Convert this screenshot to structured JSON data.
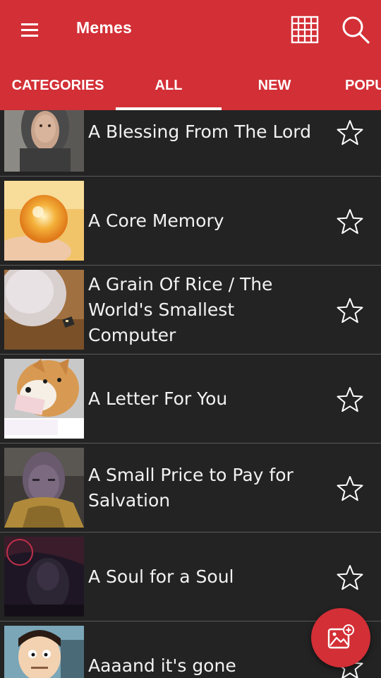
{
  "app": {
    "title": "Memes"
  },
  "tabs": [
    {
      "label": "CATEGORIES",
      "active": false
    },
    {
      "label": "ALL",
      "active": true
    },
    {
      "label": "NEW",
      "active": false
    },
    {
      "label": "POPU",
      "active": false
    }
  ],
  "memes": [
    {
      "title": "A Blessing From The Lord",
      "thumb": "knight-helmet-portrait",
      "favorite": false
    },
    {
      "title": "A Core Memory",
      "thumb": "glowing-orb-in-hands",
      "favorite": false
    },
    {
      "title": "A Grain Of Rice / The World's Smallest Computer",
      "thumb": "fingertip-with-tiny-chip",
      "favorite": false
    },
    {
      "title": "A Letter For You",
      "thumb": "shiba-dog-holding-letter",
      "favorite": false
    },
    {
      "title": "A Small Price to Pay for Salvation",
      "thumb": "thanos-portrait",
      "favorite": false
    },
    {
      "title": "A Soul for a Soul",
      "thumb": "thanos-dark-red-scene",
      "favorite": false
    },
    {
      "title": "Aaaand it's gone",
      "thumb": "cartoon-banker",
      "favorite": false
    }
  ],
  "icons": {
    "menu": "hamburger-menu-icon",
    "grid": "grid-view-icon",
    "search": "search-icon",
    "favorite": "star-outline-icon",
    "fab": "add-image-icon"
  },
  "colors": {
    "primary": "#d32f36",
    "background": "#232323",
    "text": "#f2f2f2",
    "divider": "#5a5a5a"
  }
}
